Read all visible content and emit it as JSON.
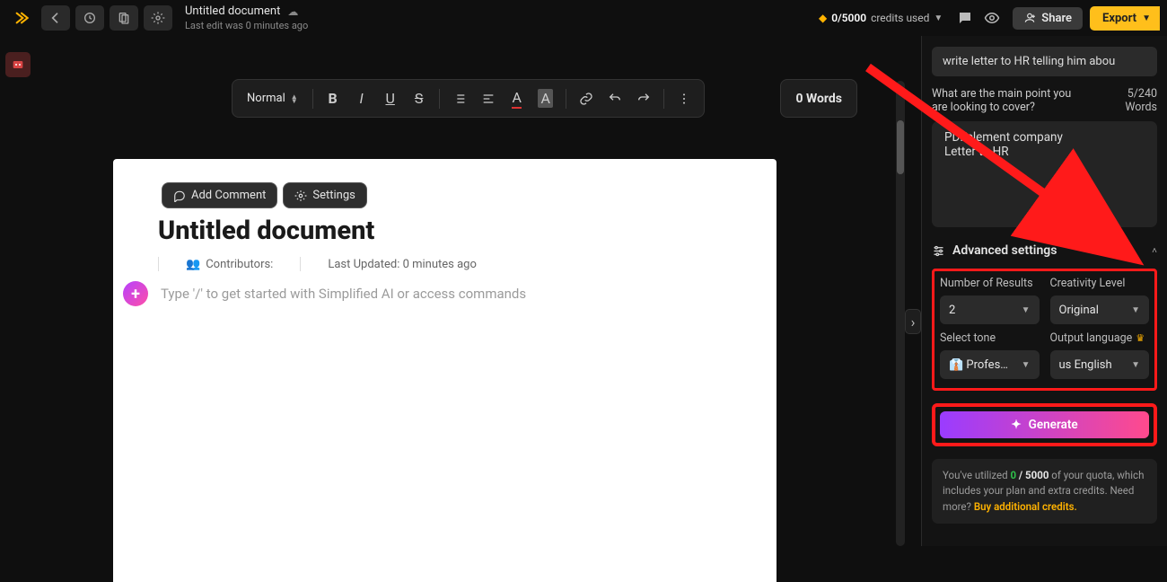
{
  "header": {
    "title": "Untitled document",
    "last_edit": "Last edit was 0 minutes ago",
    "credits_used": "0/5000",
    "credits_label": "credits used",
    "share_label": "Share",
    "export_label": "Export"
  },
  "toolbar": {
    "style_select": "Normal",
    "word_count": "0 Words"
  },
  "page_actions": {
    "add_comment": "Add Comment",
    "settings": "Settings"
  },
  "document": {
    "heading": "Untitled document",
    "contributors_label": "Contributors:",
    "last_updated": "Last Updated: 0 minutes ago",
    "placeholder": "Type '/' to get started with Simplified AI or access commands"
  },
  "panel": {
    "prompt": "write letter to HR telling him abou",
    "question": "What are the main point you are looking to cover?",
    "counter_top": "5/240",
    "counter_bottom": "Words",
    "cover_line1": "PDFelement company",
    "cover_line2": "Letter to HR",
    "advanced_label": "Advanced settings",
    "num_results_label": "Number of Results",
    "num_results_value": "2",
    "creativity_label": "Creativity Level",
    "creativity_value": "Original",
    "tone_label": "Select tone",
    "tone_value": "👔 Profes…",
    "lang_label": "Output language",
    "lang_value": "us English",
    "generate_label": "Generate"
  },
  "quota": {
    "prefix": "You've utilized ",
    "used": "0",
    "sep": " / ",
    "total": "5000",
    "middle": " of your quota, which includes your plan and extra credits. Need more? ",
    "link": "Buy additional credits."
  }
}
